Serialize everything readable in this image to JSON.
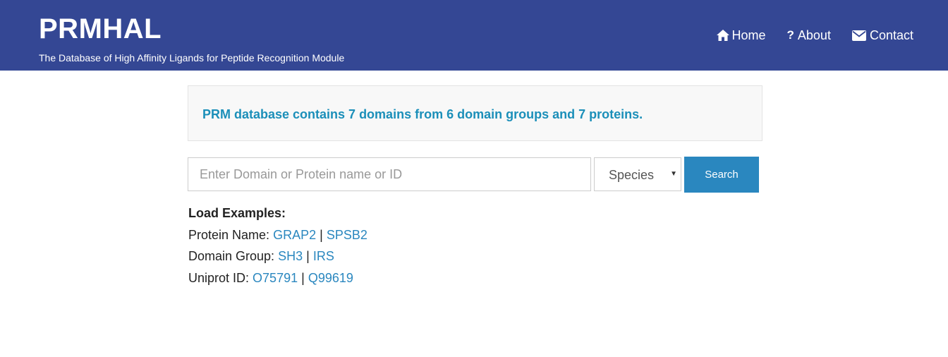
{
  "header": {
    "title": "PRMHAL",
    "subtitle": "The Database of High Affinity Ligands for Peptide Recognition Module",
    "background_color": "#344794",
    "nav": [
      {
        "label": "Home",
        "icon": "home-icon"
      },
      {
        "label": "About",
        "icon": "question-icon"
      },
      {
        "label": "Contact",
        "icon": "envelope-icon"
      }
    ]
  },
  "info": {
    "text": "PRM database contains 7 domains from 6 domain groups and 7 proteins.",
    "text_color": "#1b8fb9"
  },
  "search": {
    "placeholder": "Enter Domain or Protein name or ID",
    "value": "",
    "species_selected": "Species",
    "button_label": "Search",
    "button_color": "#2a87bf"
  },
  "examples": {
    "heading": "Load Examples:",
    "separator": "|",
    "rows": [
      {
        "label": "Protein Name:",
        "links": [
          "GRAP2",
          "SPSB2"
        ]
      },
      {
        "label": "Domain Group:",
        "links": [
          "SH3",
          "IRS"
        ]
      },
      {
        "label": "Uniprot ID:",
        "links": [
          "O75791",
          "Q99619"
        ]
      }
    ],
    "link_color": "#2a87bf"
  }
}
